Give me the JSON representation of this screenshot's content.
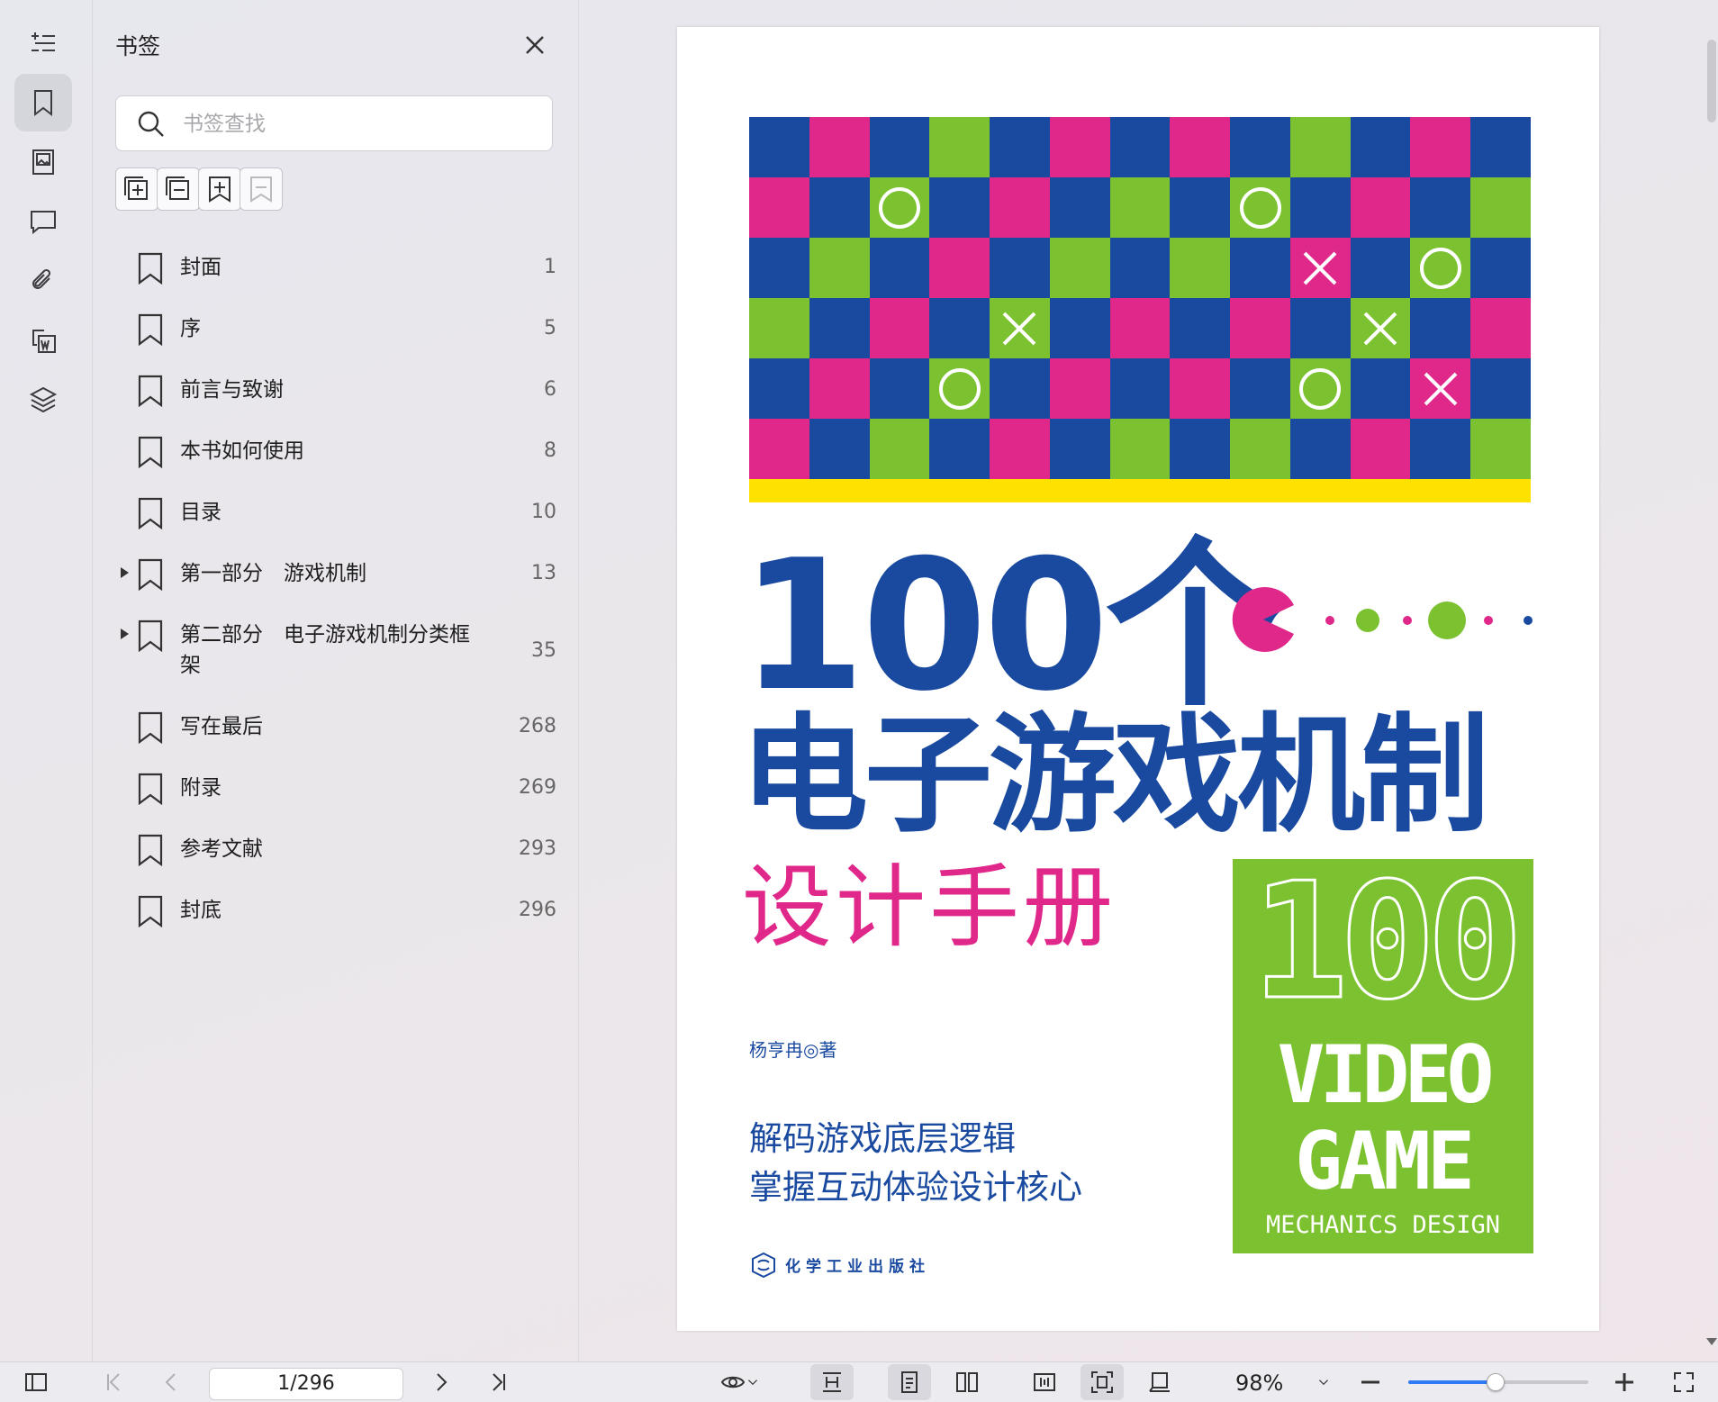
{
  "sidebar_rail": {
    "items": [
      {
        "name": "outline-icon"
      },
      {
        "name": "bookmark-icon",
        "active": true
      },
      {
        "name": "thumbnail-icon"
      },
      {
        "name": "comment-icon"
      },
      {
        "name": "attachment-icon"
      },
      {
        "name": "convert-icon"
      },
      {
        "name": "layers-icon"
      }
    ]
  },
  "bookmark_panel": {
    "title": "书签",
    "search_placeholder": "书签查找",
    "items": [
      {
        "label": "封面",
        "page": "1",
        "expandable": false
      },
      {
        "label": "序",
        "page": "5",
        "expandable": false
      },
      {
        "label": "前言与致谢",
        "page": "6",
        "expandable": false
      },
      {
        "label": "本书如何使用",
        "page": "8",
        "expandable": false
      },
      {
        "label": "目录",
        "page": "10",
        "expandable": false
      },
      {
        "label": "第一部分　游戏机制",
        "page": "13",
        "expandable": true
      },
      {
        "label": "第二部分　电子游戏机制分类框架",
        "page": "35",
        "expandable": true
      },
      {
        "label": "写在最后",
        "page": "268",
        "expandable": false
      },
      {
        "label": "附录",
        "page": "269",
        "expandable": false
      },
      {
        "label": "参考文献",
        "page": "293",
        "expandable": false
      },
      {
        "label": "封底",
        "page": "296",
        "expandable": false
      }
    ]
  },
  "cover": {
    "title_line1": "100个",
    "title_line2": "电子游戏机制",
    "title_line3": "设计手册",
    "author": "杨亨冉◎著",
    "slogan_line1": "解码游戏底层逻辑",
    "slogan_line2": "掌握互动体验设计核心",
    "publisher": "化学工业出版社",
    "box_number": "100",
    "box_line1": "VIDEO",
    "box_line2": "GAME",
    "box_line3": "MECHANICS DESIGN",
    "colors": {
      "blue": "#1a4aa0",
      "pink": "#e0288a",
      "green": "#7cc130",
      "yellow": "#ffe100"
    },
    "checker": [
      [
        "b",
        "p",
        "b",
        "g",
        "b",
        "p",
        "b",
        "p",
        "b",
        "g",
        "b",
        "p",
        "b"
      ],
      [
        "p",
        "b",
        "g",
        "b",
        "p",
        "b",
        "g",
        "b",
        "g",
        "b",
        "p",
        "b",
        "g"
      ],
      [
        "b",
        "g",
        "b",
        "p",
        "b",
        "g",
        "b",
        "g",
        "b",
        "p",
        "b",
        "g",
        "b"
      ],
      [
        "g",
        "b",
        "p",
        "b",
        "g",
        "b",
        "p",
        "b",
        "p",
        "b",
        "g",
        "b",
        "p"
      ],
      [
        "b",
        "p",
        "b",
        "g",
        "b",
        "p",
        "b",
        "p",
        "b",
        "g",
        "b",
        "p",
        "b"
      ],
      [
        "p",
        "b",
        "g",
        "b",
        "p",
        "b",
        "g",
        "b",
        "g",
        "b",
        "p",
        "b",
        "g"
      ]
    ],
    "marks": [
      {
        "row": 1,
        "col": 2,
        "type": "o"
      },
      {
        "row": 1,
        "col": 8,
        "type": "o"
      },
      {
        "row": 2,
        "col": 9,
        "type": "x"
      },
      {
        "row": 2,
        "col": 11,
        "type": "o"
      },
      {
        "row": 3,
        "col": 4,
        "type": "x"
      },
      {
        "row": 3,
        "col": 10,
        "type": "x"
      },
      {
        "row": 4,
        "col": 3,
        "type": "o"
      },
      {
        "row": 4,
        "col": 9,
        "type": "o"
      },
      {
        "row": 4,
        "col": 11,
        "type": "x"
      }
    ]
  },
  "toolbar": {
    "page_field": "1/296",
    "zoom": "98%",
    "zoom_fraction": 0.48
  }
}
